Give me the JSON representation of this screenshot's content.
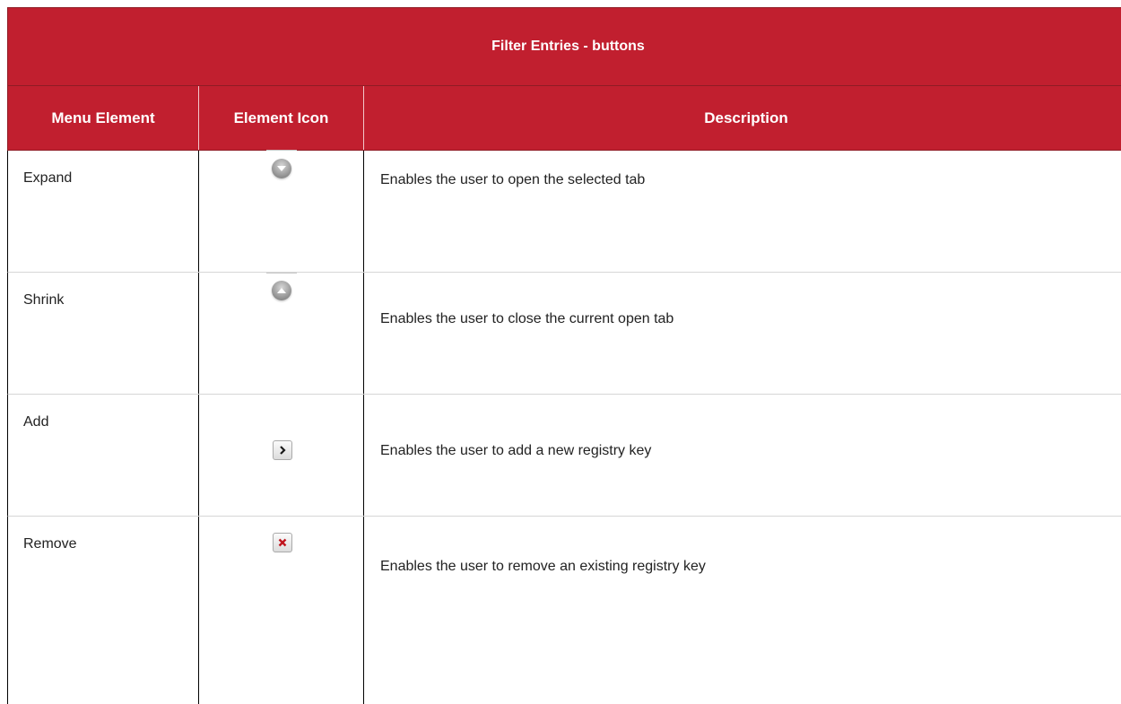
{
  "table": {
    "title": "Filter Entries - buttons",
    "headers": [
      "Menu Element",
      "Element Icon",
      "Description"
    ],
    "rows": [
      {
        "element": "Expand",
        "icon": "expand-circle-down-icon",
        "description": "Enables the user to open the selected tab"
      },
      {
        "element": "Shrink",
        "icon": "shrink-circle-up-icon",
        "description": "Enables the user to close the current open tab"
      },
      {
        "element": "Add",
        "icon": "add-arrow-right-icon",
        "description": "Enables the user to add a new registry key"
      },
      {
        "element": "Remove",
        "icon": "remove-x-icon",
        "description": "Enables the user to remove an existing registry key"
      }
    ]
  },
  "colors": {
    "header_bg": "#c11f2f",
    "header_text": "#ffffff",
    "remove_icon": "#c0141e"
  }
}
